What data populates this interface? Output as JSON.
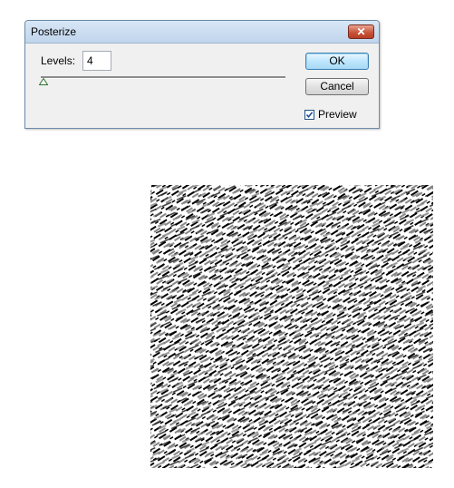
{
  "dialog": {
    "title": "Posterize",
    "close_symbol": "✕",
    "levels_label": "Levels:",
    "levels_value": "4",
    "ok_label": "OK",
    "cancel_label": "Cancel",
    "preview_label": "Preview",
    "preview_checked": true
  },
  "image": {
    "description_icon": "posterized-texture"
  }
}
